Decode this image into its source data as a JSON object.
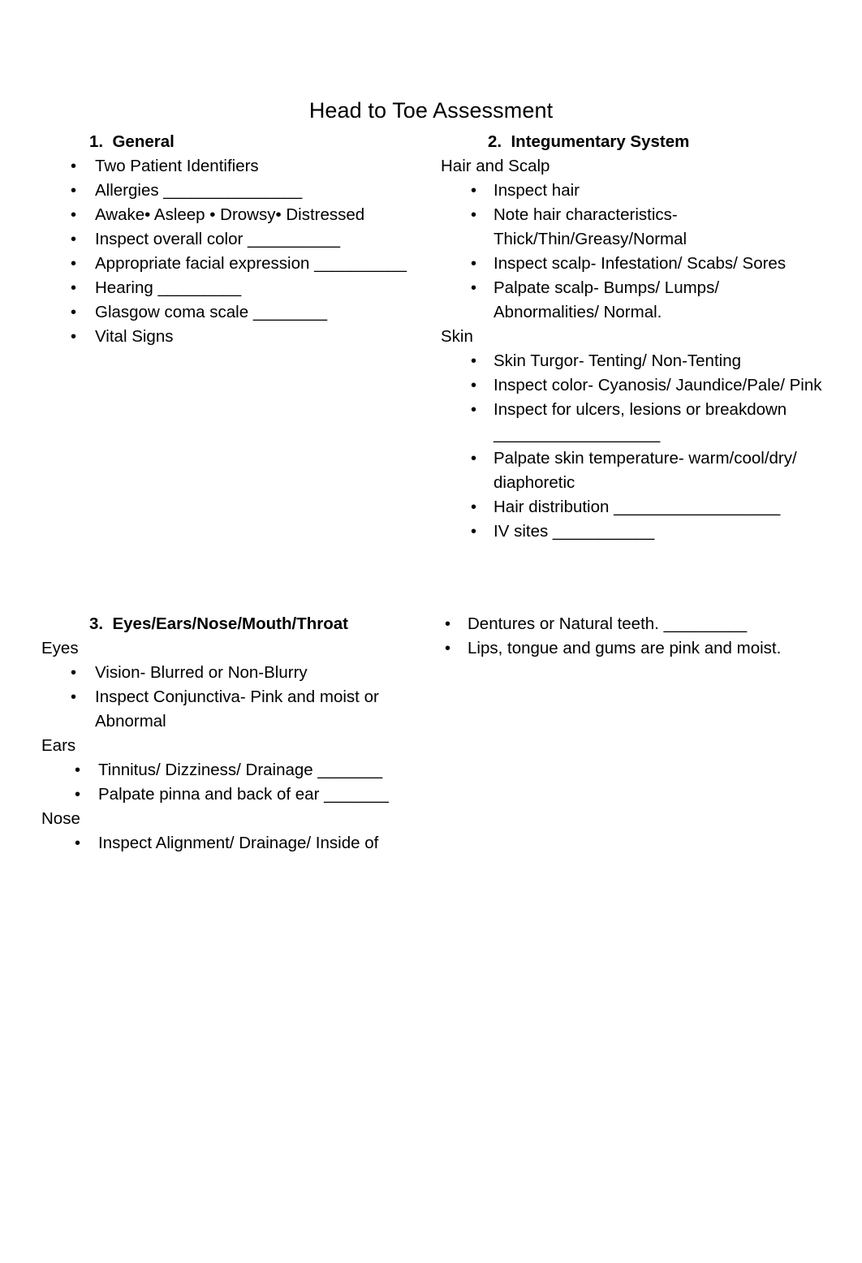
{
  "document": {
    "title": "Head to Toe Assessment"
  },
  "bullet_glyph": "•",
  "sections": {
    "general": {
      "heading": "1.  General",
      "items": [
        "Two Patient Identifiers",
        "Allergies _______________",
        "Awake• Asleep • Drowsy• Distressed",
        "Inspect overall color __________",
        "Appropriate facial expression __________",
        "Hearing _________",
        "Glasgow coma scale ________",
        "Vital Signs"
      ]
    },
    "integumentary": {
      "heading": "2.  Integumentary System",
      "groups": [
        {
          "label": "Hair and Scalp",
          "items": [
            "Inspect hair",
            "Note hair characteristics- Thick/Thin/Greasy/Normal",
            "Inspect scalp- Infestation/ Scabs/ Sores",
            "Palpate scalp- Bumps/ Lumps/ Abnormalities/ Normal."
          ]
        },
        {
          "label": "Skin",
          "items": [
            "Skin Turgor- Tenting/ Non-Tenting",
            "Inspect color- Cyanosis/ Jaundice/Pale/ Pink",
            "Inspect for ulcers, lesions or breakdown __________________",
            "Palpate skin temperature- warm/cool/dry/ diaphoretic",
            "Hair distribution __________________",
            "IV sites ___________"
          ]
        }
      ]
    },
    "eent": {
      "heading": "3.  Eyes/Ears/Nose/Mouth/Throat",
      "groups": [
        {
          "label": "Eyes",
          "items": [
            "Vision- Blurred or Non-Blurry",
            "Inspect Conjunctiva- Pink and moist or Abnormal"
          ]
        },
        {
          "label": "Ears",
          "items": [
            "Tinnitus/ Dizziness/ Drainage _______",
            "Palpate pinna and back of ear _______"
          ]
        },
        {
          "label": "Nose",
          "items": [
            "Inspect Alignment/ Drainage/ Inside of"
          ]
        }
      ],
      "continued_items": [
        "Dentures or Natural teeth. _________",
        "Lips, tongue and gums are pink and moist."
      ]
    }
  }
}
